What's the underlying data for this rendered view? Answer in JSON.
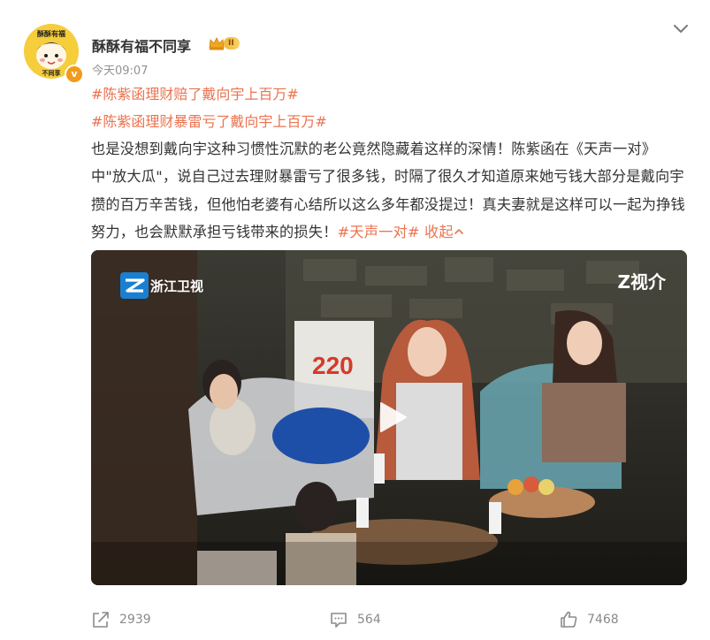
{
  "post": {
    "username": "酥酥有福不同享",
    "vip_level": "II",
    "verified_badge": "v",
    "timestamp": "今天09:07",
    "hashtags": [
      "#陈紫函理财赔了戴向宇上百万#",
      "#陈紫函理财暴雷亏了戴向宇上百万#"
    ],
    "body_text": "也是没想到戴向宇这种习惯性沉默的老公竟然隐藏着这样的深情！陈紫函在《天声一对》中\"放大瓜\"，说自己过去理财暴雷亏了很多钱，时隔了很久才知道原来她亏钱大部分是戴向宇攒的百万辛苦钱，但他怕老婆有心结所以这么多年都没提过！真夫妻就是这样可以一起为挣钱努力，也会默默承担亏钱带来的损失！",
    "inline_hashtag": "#天声一对#",
    "collapse_label": "收起",
    "avatar_text": [
      "酥酥有福",
      "不同享"
    ]
  },
  "video": {
    "channel_logo_text": "浙江卫视",
    "corner_logo_text": "Z视介",
    "box_number": "220"
  },
  "actions": {
    "share_count": "2939",
    "comment_count": "564",
    "like_count": "7468"
  },
  "icons": {
    "more": "chevron-down-icon",
    "share": "share-icon",
    "comment": "comment-icon",
    "like": "thumbs-up-icon",
    "play": "play-icon"
  },
  "colors": {
    "accent": "#eb7350",
    "text": "#333333",
    "muted": "#939393"
  }
}
